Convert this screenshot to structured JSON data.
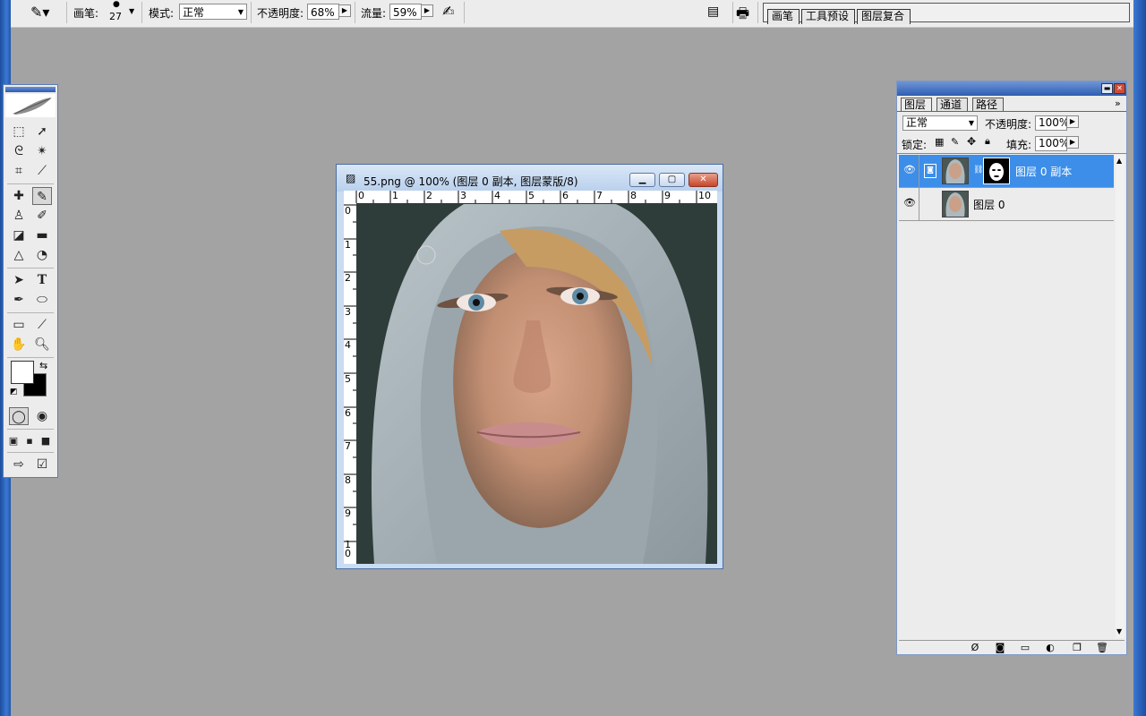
{
  "options_bar": {
    "brush_label": "画笔:",
    "brush_size": "27",
    "mode_label": "模式:",
    "mode_value": "正常",
    "opacity_label": "不透明度:",
    "opacity_value": "68%",
    "flow_label": "流量:",
    "flow_value": "59%"
  },
  "palette_well": {
    "tabs": [
      "画笔",
      "工具预设",
      "图层复合"
    ]
  },
  "document": {
    "title": "55.png @ 100% (图层 0 副本, 图层蒙版/8)",
    "ruler_top": [
      "0",
      "1",
      "2",
      "3",
      "4",
      "5",
      "6",
      "7",
      "8",
      "9",
      "10"
    ],
    "ruler_left": [
      "0",
      "1",
      "2",
      "3",
      "4",
      "5",
      "6",
      "7",
      "8",
      "9",
      "1",
      "0"
    ]
  },
  "layers_panel": {
    "tabs": [
      "图层",
      "通道",
      "路径"
    ],
    "blend_mode": "正常",
    "opacity_label": "不透明度:",
    "opacity_value": "100%",
    "lock_label": "锁定:",
    "fill_label": "填充:",
    "fill_value": "100%",
    "layers": [
      {
        "name": "图层 0 副本",
        "selected": true
      },
      {
        "name": "图层 0",
        "selected": false
      }
    ]
  },
  "colors": {
    "workspace": "#a3a3a3",
    "selection": "#3c8ee9",
    "window_frame": "#c9dcf2"
  }
}
